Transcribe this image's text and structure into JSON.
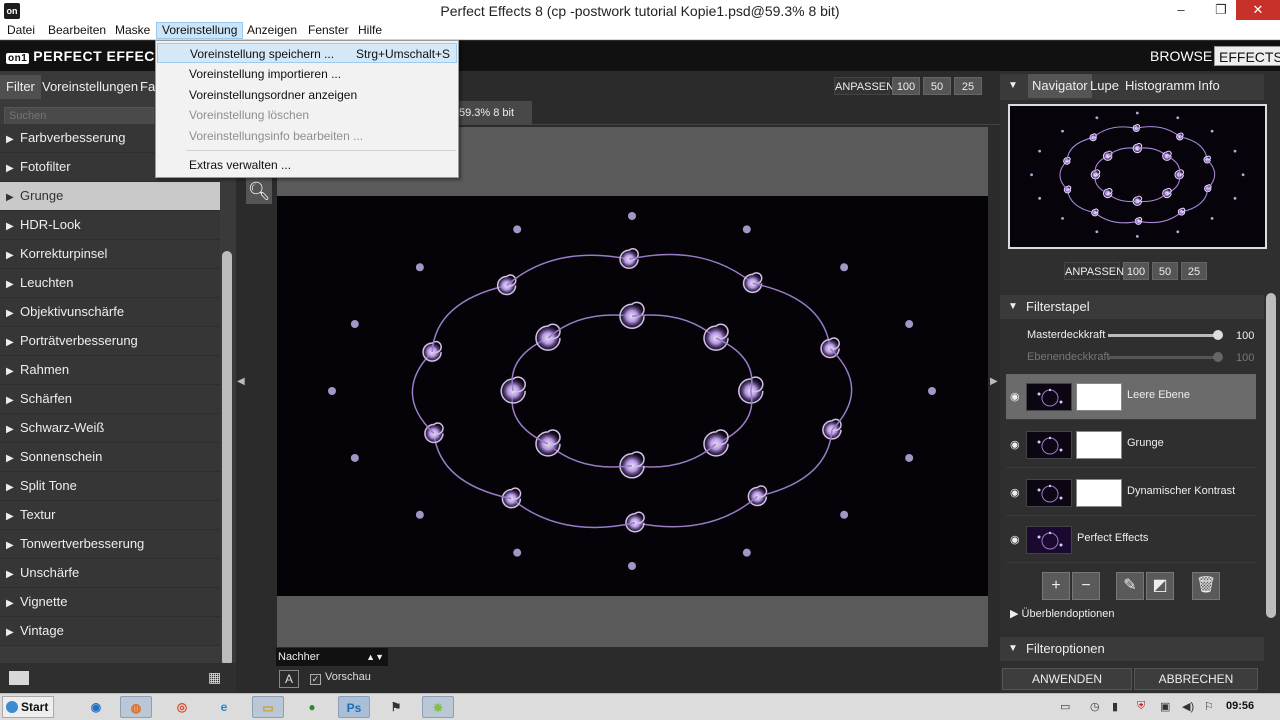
{
  "window": {
    "title": "Perfect Effects 8 (cp -postwork tutorial Kopie1.psd@59.3% 8 bit)",
    "controls": [
      "–",
      "❐",
      "✕"
    ]
  },
  "menubar": [
    "Datei",
    "Bearbeiten",
    "Maske",
    "Voreinstellung",
    "Anzeigen",
    "Fenster",
    "Hilfe"
  ],
  "dropdown": {
    "items": [
      {
        "label": "Voreinstellung speichern ...",
        "shortcut": "Strg+Umschalt+S",
        "state": "hover"
      },
      {
        "label": "Voreinstellung importieren ...",
        "shortcut": "",
        "state": "enabled"
      },
      {
        "label": "Voreinstellungsordner anzeigen",
        "shortcut": "",
        "state": "enabled"
      },
      {
        "label": "Voreinstellung löschen",
        "shortcut": "",
        "state": "disabled"
      },
      {
        "label": "Voreinstellungsinfo bearbeiten ...",
        "shortcut": "",
        "state": "disabled"
      },
      {
        "label": "Extras verwalten ...",
        "shortcut": "",
        "state": "enabled"
      }
    ]
  },
  "header": {
    "logo_badge": "on1",
    "logo_text": "PERFECT EFFECTS",
    "browse": "BROWSE",
    "effects": "EFFECTS"
  },
  "left": {
    "tabs": [
      "Filter",
      "Voreinstellungen",
      "Fav"
    ],
    "search_placeholder": "Suchen",
    "filters": [
      "Farbverbesserung",
      "Fotofilter",
      "Grunge",
      "HDR-Look",
      "Korrekturpinsel",
      "Leuchten",
      "Objektivunschärfe",
      "Porträtverbesserung",
      "Rahmen",
      "Schärfen",
      "Schwarz-Weiß",
      "Sonnenschein",
      "Split Tone",
      "Textur",
      "Tonwertverbesserung",
      "Unschärfe",
      "Vignette",
      "Vintage"
    ],
    "selected": "Grunge"
  },
  "center": {
    "zoom_label": "ANPASSEN",
    "zoom_values": [
      "100",
      "50",
      "25"
    ],
    "doc_tab": "59.3% 8 bit",
    "view_mode": "Nachher",
    "a_button": "A",
    "preview_label": "Vorschau",
    "preview_checked": true
  },
  "right": {
    "nav_tabs": [
      "Navigator",
      "Lupe",
      "Histogramm",
      "Info"
    ],
    "nav_zoom_label": "ANPASSEN",
    "nav_zoom_values": [
      "100",
      "50",
      "25"
    ],
    "stack_title": "Filterstapel",
    "master_label": "Masterdeckkraft",
    "master_value": "100",
    "layer_opacity_label": "Ebenendeckkraft",
    "layer_opacity_value": "100",
    "layers": [
      "Leere Ebene",
      "Grunge",
      "Dynamischer Kontrast",
      "Perfect Effects"
    ],
    "blend_label": "Überblendoptionen",
    "options_title": "Filteroptionen",
    "apply": "ANWENDEN",
    "cancel": "ABBRECHEN"
  },
  "taskbar": {
    "start": "Start",
    "clock": "09:56",
    "apps": [
      "ie-icon",
      "firefox-icon",
      "chrome-icon",
      "ie-blue-icon",
      "explorer-icon",
      "nero-icon",
      "photoshop-icon",
      "daz-icon",
      "perfect-effects-icon"
    ]
  }
}
